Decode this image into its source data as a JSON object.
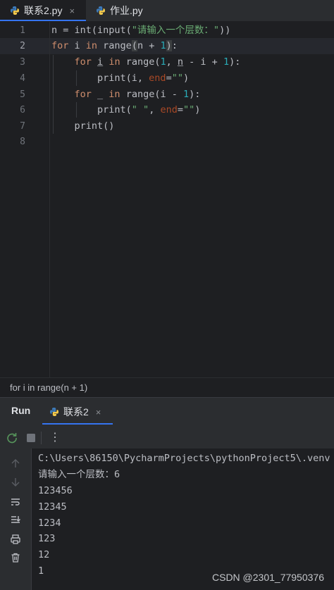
{
  "tabs": [
    {
      "label": "联系2.py",
      "active": true,
      "close": "×"
    },
    {
      "label": "作业.py",
      "active": false
    }
  ],
  "editor": {
    "line_numbers": [
      "1",
      "2",
      "3",
      "4",
      "5",
      "6",
      "7",
      "8"
    ],
    "current_line": 2
  },
  "breadcrumb": "for i in range(n + 1)",
  "run_panel": {
    "title": "Run",
    "tab_label": "联系2",
    "tab_close": "×",
    "output": [
      "C:\\Users\\86150\\PycharmProjects\\pythonProject5\\.venv",
      "请输入一个层数：6",
      "123456",
      "12345",
      "1234",
      "123",
      "12",
      "1"
    ]
  },
  "toolbar": {
    "more": "⋮"
  },
  "watermark": "CSDN @2301_77950376",
  "colors": {
    "accent": "#3574f0",
    "keyword": "#cf8e6d",
    "string": "#6aab73",
    "number": "#2aacb8"
  }
}
